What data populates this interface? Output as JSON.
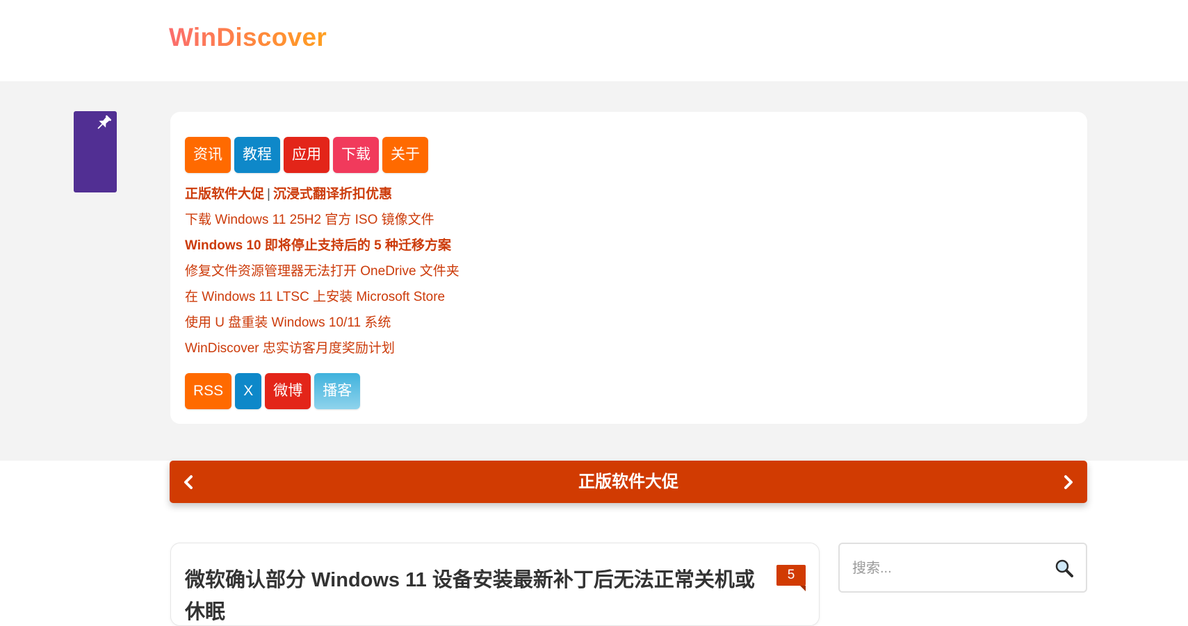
{
  "site": {
    "logo": "WinDiscover"
  },
  "nav": {
    "categories": [
      {
        "label": "资讯",
        "color": "#ff6a00"
      },
      {
        "label": "教程",
        "color": "#0e88c9"
      },
      {
        "label": "应用",
        "color": "#e32519"
      },
      {
        "label": "下载",
        "color": "#f13a5c"
      },
      {
        "label": "关于",
        "color": "#ff6a00"
      }
    ],
    "featured_links": {
      "first_a": "正版软件大促",
      "first_sep": "|",
      "first_b": "沉浸式翻译折扣优惠",
      "items": [
        "下载 Windows 11 25H2 官方 ISO 镜像文件",
        "Windows 10 即将停止支持后的 5 种迁移方案",
        "修复文件资源管理器无法打开 OneDrive 文件夹",
        "在 Windows 11 LTSC 上安装 Microsoft Store",
        "使用 U 盘重装 Windows 10/11 系统",
        "WinDiscover 忠实访客月度奖励计划"
      ]
    },
    "social": [
      {
        "label": "RSS",
        "color": "#ff6a00"
      },
      {
        "label": "X",
        "color": "#0e88c9"
      },
      {
        "label": "微博",
        "color": "#e32519"
      },
      {
        "label": "播客",
        "color": "#47b8de"
      }
    ]
  },
  "banner": {
    "title": "正版软件大促",
    "prev_icon": "chevron-left-icon",
    "next_icon": "chevron-right-icon"
  },
  "post": {
    "title": "微软确认部分 Windows 11 设备安装最新补丁后无法正常关机或休眠",
    "comment_count": "5"
  },
  "search": {
    "placeholder": "搜索...",
    "icon": "magnifier-icon"
  },
  "colors": {
    "accent": "#d13b02",
    "pin_tab": "#512f93",
    "link": "#cc3b0a",
    "band": "#f3f3f3"
  }
}
